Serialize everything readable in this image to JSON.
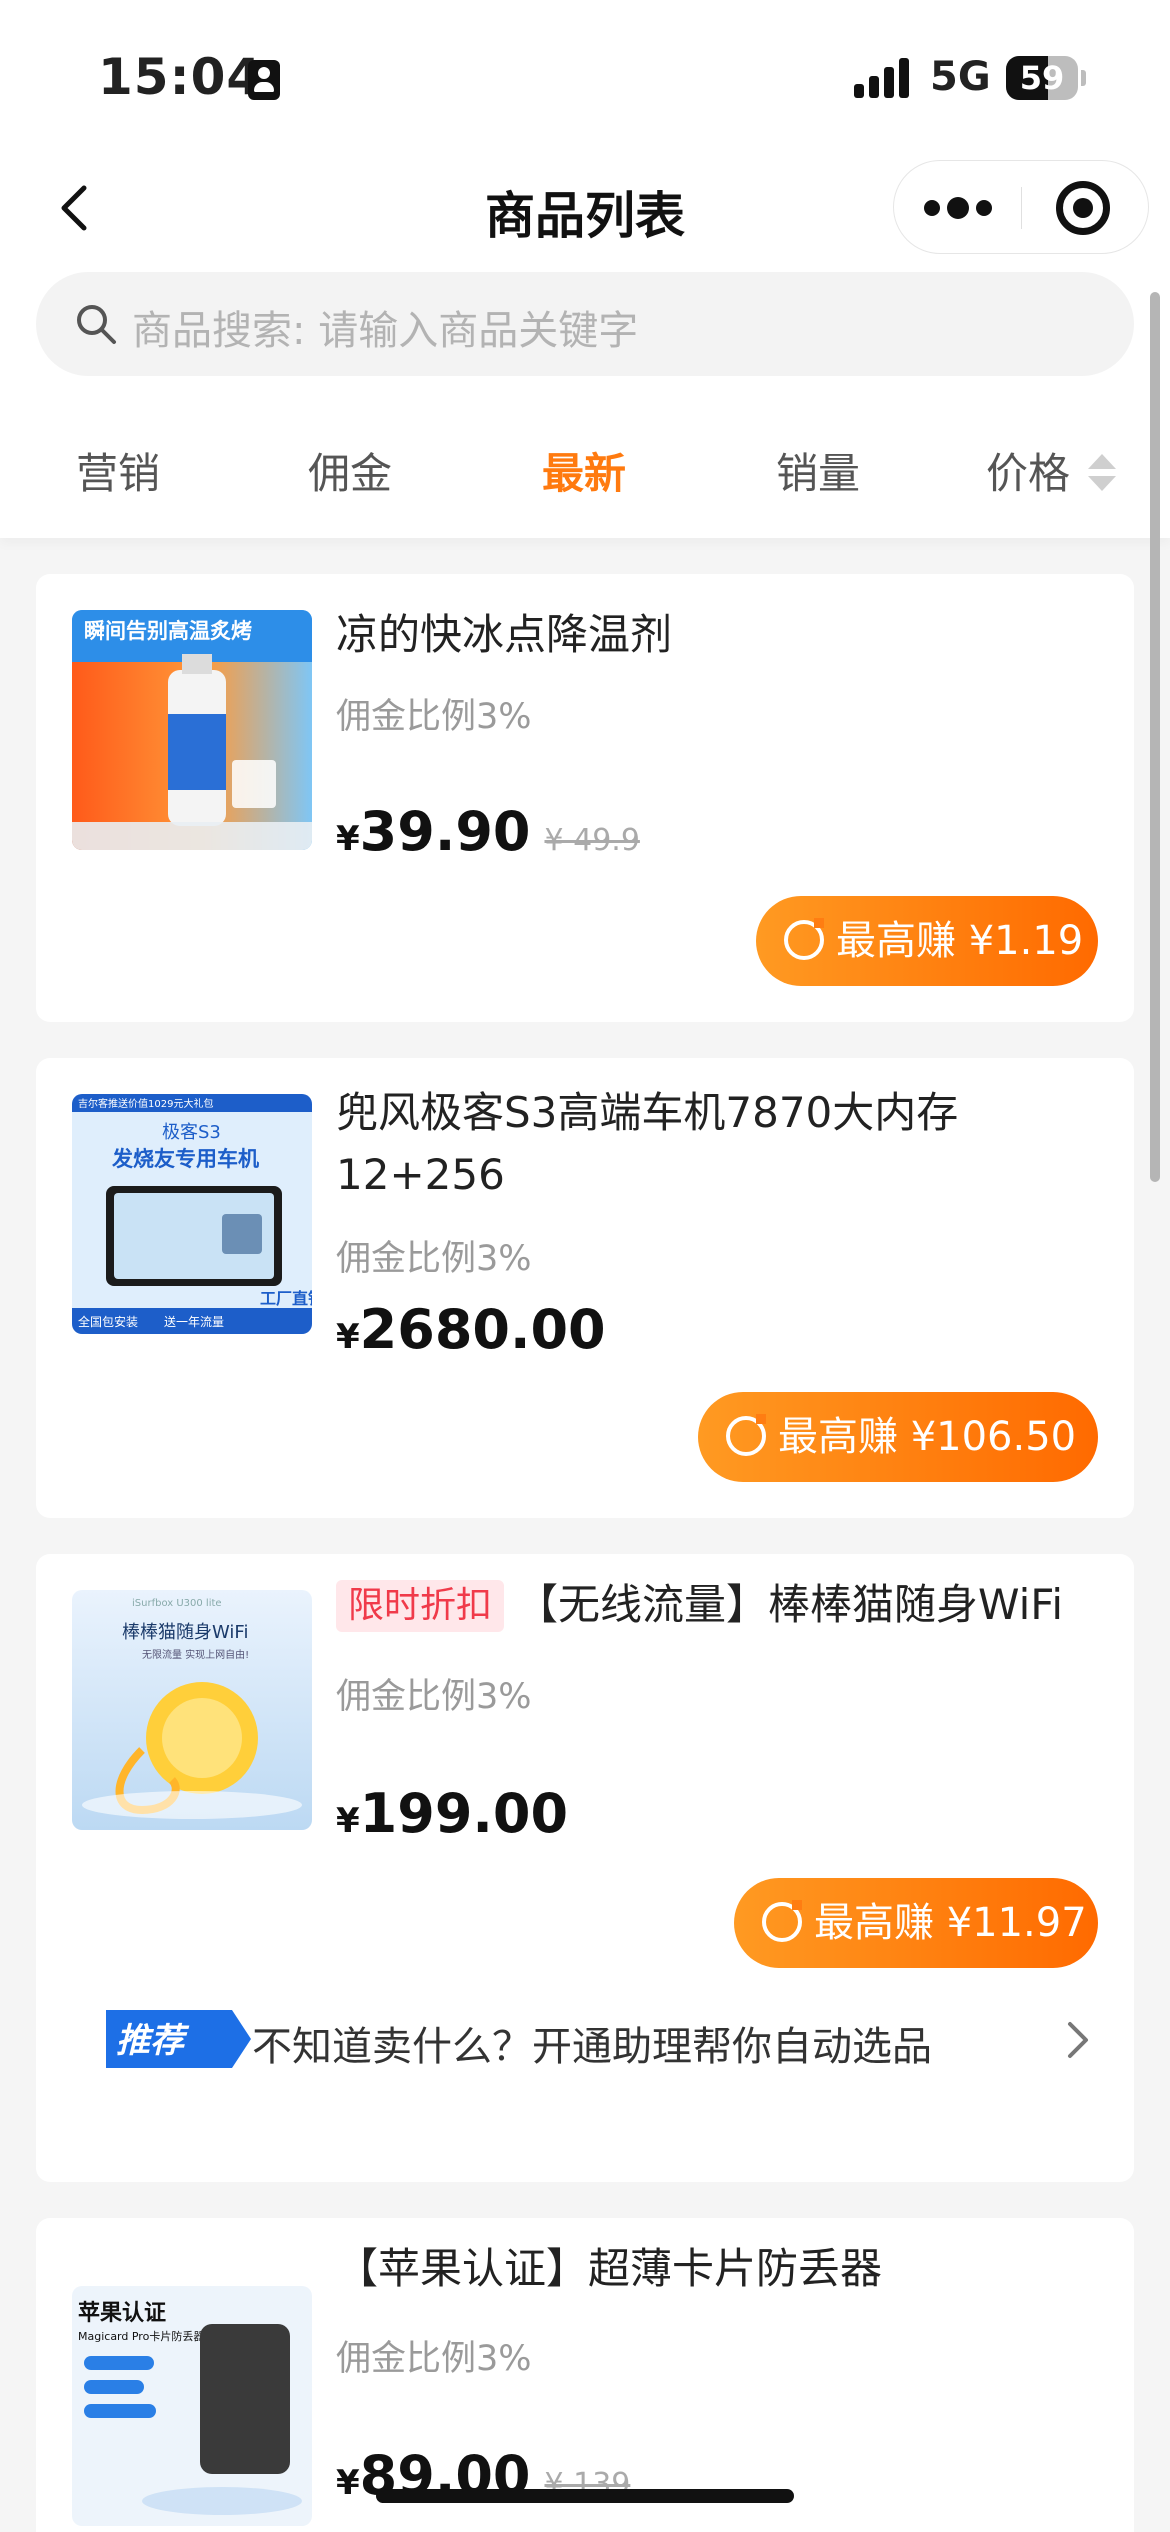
{
  "status_bar": {
    "time": "15:04",
    "network": "5G",
    "battery_level": "59",
    "battery_fraction": 0.59,
    "signal_bars": 4
  },
  "nav": {
    "title": "商品列表",
    "back_icon": "chevron-left-icon",
    "more_icon": "more-dots-icon",
    "close_icon": "target-circle-icon"
  },
  "search": {
    "placeholder": "商品搜索: 请输入商品关键字",
    "icon": "search-icon"
  },
  "tabs": [
    {
      "label": "营销",
      "active": false
    },
    {
      "label": "佣金",
      "active": false
    },
    {
      "label": "最新",
      "active": true
    },
    {
      "label": "销量",
      "active": false
    },
    {
      "label": "价格",
      "active": false,
      "sort_icon": "sort-arrows-icon"
    }
  ],
  "colors": {
    "accent": "#ff7a0f",
    "earn_gradient_start": "#ff9a22",
    "earn_gradient_end": "#ff6a00",
    "tag_text": "#f03a4a",
    "tag_bg": "#ffe7ea",
    "page_bg": "#f5f5f5"
  },
  "products": [
    {
      "title": "凉的快冰点降温剂",
      "commission": "佣金比例3%",
      "currency": "¥",
      "price": "39.90",
      "original_price": "¥ 49.9",
      "earn_label": "最高赚 ¥1.19",
      "image": {
        "banner": "瞬间告别高温炙烤"
      }
    },
    {
      "title": "兜风极客S3高端车机7870大内存12+256",
      "commission": "佣金比例3%",
      "currency": "¥",
      "price": "2680.00",
      "earn_label": "最高赚 ¥106.50",
      "image": {
        "header": "吉尔客推送价值1029元大礼包",
        "model": "极客S3",
        "tagline": "发烧友专用车机",
        "footer_left": "全国包安装",
        "footer_mid": "送一年流量",
        "footer_right": "工厂直销"
      }
    },
    {
      "tag": "限时折扣",
      "title": "【无线流量】棒棒猫随身WiFi",
      "commission": "佣金比例3%",
      "currency": "¥",
      "price": "199.00",
      "earn_label": "最高赚 ¥11.97",
      "recommendation": {
        "badge": "推荐",
        "text": "不知道卖什么？开通助理帮你自动选品"
      },
      "image": {
        "model": "iSurfbox U300 lite",
        "name": "棒棒猫随身WiFi",
        "tagline": "无限流量 实现上网自由!"
      }
    },
    {
      "title": "【苹果认证】超薄卡片防丢器",
      "commission": "佣金比例3%",
      "currency": "¥",
      "price": "89.00",
      "original_price": "¥ 139",
      "image": {
        "name": "苹果认证",
        "subtitle": "Magicard Pro卡片防丢器"
      }
    }
  ]
}
